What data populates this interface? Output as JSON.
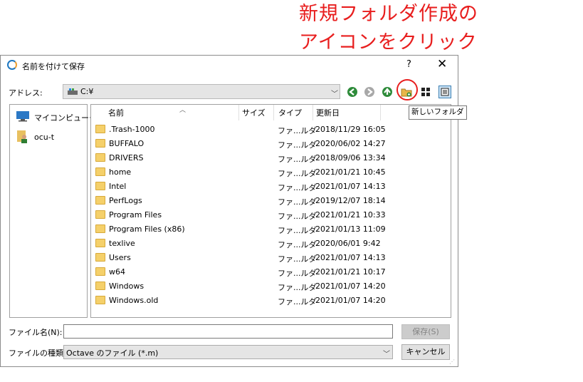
{
  "annotation": {
    "line1": "新規フォルダ作成の",
    "line2": "アイコンをクリック"
  },
  "dialog": {
    "title": "名前を付けて保存",
    "help": "?",
    "close": "✕",
    "address_label": "アドレス:",
    "address_value": "C:¥",
    "tooltip": "新しいフォルダ"
  },
  "sidebar": {
    "items": [
      {
        "label": "マイコンピュータ",
        "icon": "computer-icon"
      },
      {
        "label": "ocu-t",
        "icon": "user-folder-icon"
      }
    ]
  },
  "columns": {
    "name": "名前",
    "size": "サイズ",
    "type": "タイプ",
    "modified": "更新日"
  },
  "files": [
    {
      "name": ".Trash-1000",
      "type": "ファ...ルダ",
      "modified": "2018/11/29 16:05"
    },
    {
      "name": "BUFFALO",
      "type": "ファ...ルダ",
      "modified": "2020/06/02 14:27"
    },
    {
      "name": "DRIVERS",
      "type": "ファ...ルダ",
      "modified": "2018/09/06 13:34"
    },
    {
      "name": "home",
      "type": "ファ...ルダ",
      "modified": "2021/01/21 10:45"
    },
    {
      "name": "Intel",
      "type": "ファ...ルダ",
      "modified": "2021/01/07 14:13"
    },
    {
      "name": "PerfLogs",
      "type": "ファ...ルダ",
      "modified": "2019/12/07 18:14"
    },
    {
      "name": "Program Files",
      "type": "ファ...ルダ",
      "modified": "2021/01/21 10:33"
    },
    {
      "name": "Program Files (x86)",
      "type": "ファ...ルダ",
      "modified": "2021/01/13 11:09"
    },
    {
      "name": "texlive",
      "type": "ファ...ルダ",
      "modified": "2020/06/01 9:42"
    },
    {
      "name": "Users",
      "type": "ファ...ルダ",
      "modified": "2021/01/07 14:13"
    },
    {
      "name": "w64",
      "type": "ファ...ルダ",
      "modified": "2021/01/21 10:17"
    },
    {
      "name": "Windows",
      "type": "ファ...ルダ",
      "modified": "2021/01/07 14:20"
    },
    {
      "name": "Windows.old",
      "type": "ファ...ルダ",
      "modified": "2021/01/07 14:20"
    }
  ],
  "footer": {
    "filename_label": "ファイル名(N):",
    "filename_value": "",
    "save": "保存(S)",
    "filetype_label": "ファイルの種類:",
    "filetype_value": "Octave のファイル (*.m)",
    "cancel": "キャンセル"
  },
  "colors": {
    "accent_red": "#e81e1e",
    "folder": "#f5d06a",
    "nav_green": "#2e8b3a"
  }
}
